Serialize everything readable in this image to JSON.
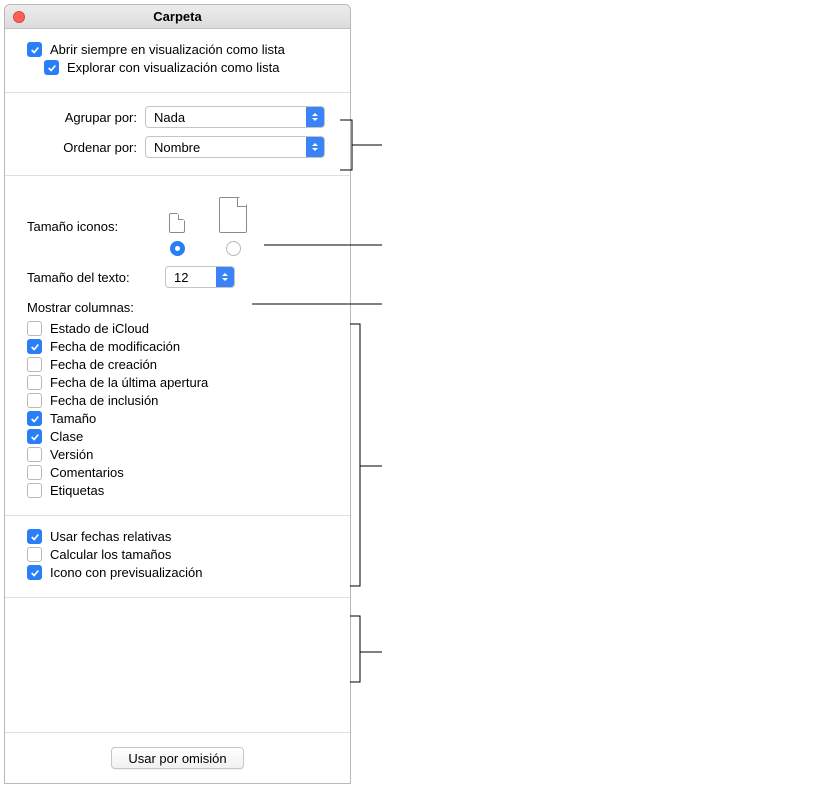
{
  "title": "Carpeta",
  "checkbox_open_list": {
    "label": "Abrir siempre en visualización como lista",
    "checked": true
  },
  "checkbox_browse_list": {
    "label": "Explorar con visualización como lista",
    "checked": true
  },
  "group_by": {
    "label": "Agrupar por:",
    "value": "Nada"
  },
  "sort_by": {
    "label": "Ordenar por:",
    "value": "Nombre"
  },
  "icon_size_label": "Tamaño iconos:",
  "icon_size_selected": "small",
  "text_size": {
    "label": "Tamaño del texto:",
    "value": "12"
  },
  "columns_heading": "Mostrar columnas:",
  "columns": [
    {
      "id": "icloud",
      "label": "Estado de iCloud",
      "checked": false
    },
    {
      "id": "mod",
      "label": "Fecha de modificación",
      "checked": true
    },
    {
      "id": "created",
      "label": "Fecha de creación",
      "checked": false
    },
    {
      "id": "last_opened",
      "label": "Fecha de la última apertura",
      "checked": false
    },
    {
      "id": "added",
      "label": "Fecha de inclusión",
      "checked": false
    },
    {
      "id": "size",
      "label": "Tamaño",
      "checked": true
    },
    {
      "id": "kind",
      "label": "Clase",
      "checked": true
    },
    {
      "id": "version",
      "label": "Versión",
      "checked": false
    },
    {
      "id": "comments",
      "label": "Comentarios",
      "checked": false
    },
    {
      "id": "tags",
      "label": "Etiquetas",
      "checked": false
    }
  ],
  "relative_dates": {
    "label": "Usar fechas relativas",
    "checked": true
  },
  "calc_sizes": {
    "label": "Calcular los tamaños",
    "checked": false
  },
  "icon_preview": {
    "label": "Icono con previsualización",
    "checked": true
  },
  "defaults_button": "Usar por omisión"
}
